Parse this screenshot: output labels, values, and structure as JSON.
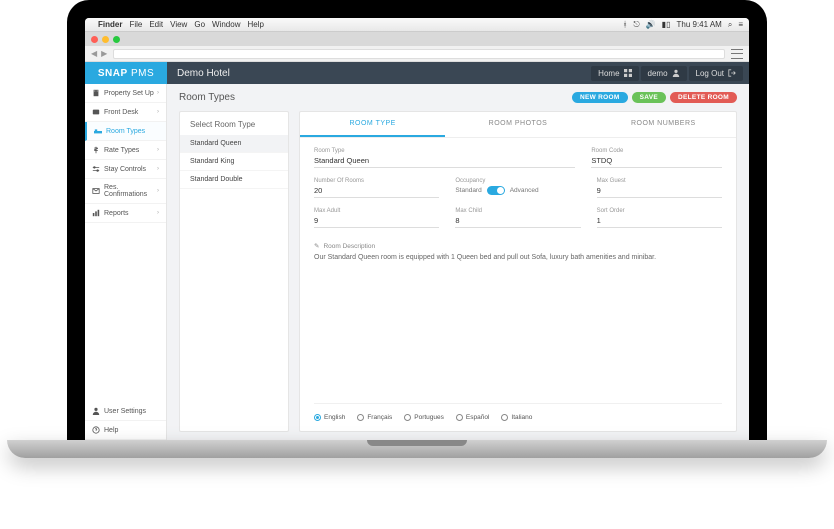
{
  "macmenu": {
    "items": [
      "Finder",
      "File",
      "Edit",
      "View",
      "Go",
      "Window",
      "Help"
    ],
    "clock": "Thu 9:41 AM"
  },
  "brand": {
    "strong": "SNAP",
    "thin": "PMS"
  },
  "hotel_name": "Demo Hotel",
  "topbar": {
    "home": "Home",
    "user": "demo",
    "logout": "Log Out"
  },
  "sidebar": {
    "items": [
      {
        "icon": "building-icon",
        "label": "Property Set Up"
      },
      {
        "icon": "desk-icon",
        "label": "Front Desk"
      },
      {
        "icon": "bed-icon",
        "label": "Room Types",
        "active": true
      },
      {
        "icon": "dollar-icon",
        "label": "Rate Types"
      },
      {
        "icon": "sliders-icon",
        "label": "Stay Controls"
      },
      {
        "icon": "mail-icon",
        "label": "Res. Confirmations"
      },
      {
        "icon": "chart-icon",
        "label": "Reports"
      }
    ],
    "footer": [
      {
        "icon": "user-icon",
        "label": "User Settings"
      },
      {
        "icon": "help-icon",
        "label": "Help"
      }
    ]
  },
  "main": {
    "title": "Room Types",
    "actions": {
      "new": "NEW ROOM",
      "save": "SAVE",
      "delete": "DELETE ROOM"
    },
    "select_panel": {
      "title": "Select Room Type",
      "items": [
        "Standard Queen",
        "Standard King",
        "Standard Double"
      ],
      "active_index": 0
    },
    "tabs": [
      "ROOM TYPE",
      "ROOM PHOTOS",
      "ROOM NUMBERS"
    ],
    "active_tab": 0,
    "form": {
      "room_type": {
        "label": "Room Type",
        "value": "Standard Queen"
      },
      "room_code": {
        "label": "Room Code",
        "value": "STDQ"
      },
      "num_rooms": {
        "label": "Number Of Rooms",
        "value": "20"
      },
      "occupancy": {
        "label": "Occupancy",
        "left": "Standard",
        "right": "Advanced"
      },
      "max_guest": {
        "label": "Max Guest",
        "value": "9"
      },
      "max_adult": {
        "label": "Max Adult",
        "value": "9"
      },
      "max_child": {
        "label": "Max Child",
        "value": "8"
      },
      "sort_order": {
        "label": "Sort Order",
        "value": "1"
      },
      "description": {
        "label": "Room Description",
        "value": "Our Standard Queen room is equipped with 1 Queen bed and pull out Sofa, luxury bath amenities and minibar."
      }
    },
    "languages": [
      "English",
      "Français",
      "Portugues",
      "Español",
      "Italiano"
    ],
    "active_lang": 0
  }
}
